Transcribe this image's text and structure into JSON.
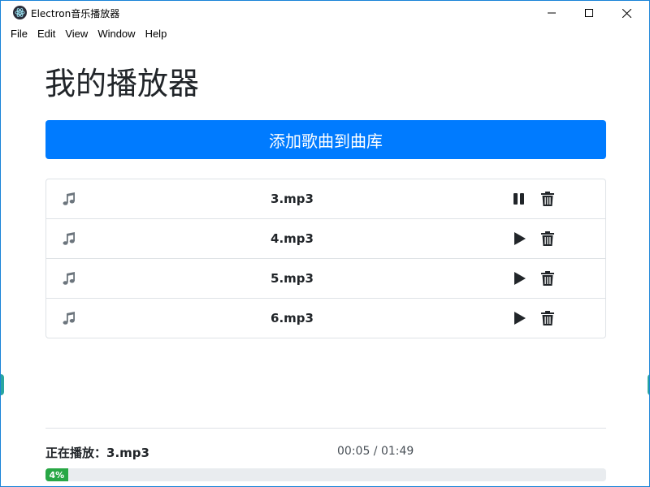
{
  "window": {
    "title": "Electron音乐播放器",
    "icon": "electron-icon",
    "controls": [
      "minimize-icon",
      "maximize-icon",
      "close-icon"
    ]
  },
  "menu": [
    "File",
    "Edit",
    "View",
    "Window",
    "Help"
  ],
  "main": {
    "title": "我的播放器",
    "add_button_label": "添加歌曲到曲库",
    "add_button_color": "#007bff"
  },
  "songs": [
    {
      "name": "3.mp3",
      "state": "playing",
      "note_icon": "music-note-icon",
      "action_icon": "pause-icon",
      "delete_icon": "trash-icon"
    },
    {
      "name": "4.mp3",
      "state": "stopped",
      "note_icon": "music-note-icon",
      "action_icon": "play-icon",
      "delete_icon": "trash-icon"
    },
    {
      "name": "5.mp3",
      "state": "stopped",
      "note_icon": "music-note-icon",
      "action_icon": "play-icon",
      "delete_icon": "trash-icon"
    },
    {
      "name": "6.mp3",
      "state": "stopped",
      "note_icon": "music-note-icon",
      "action_icon": "play-icon",
      "delete_icon": "trash-icon"
    }
  ],
  "player": {
    "now_playing_label": "正在播放：3.mp3",
    "time": "00:05 / 01:49",
    "progress_percent": 4,
    "progress_label": "4%",
    "progress_color": "#28a745"
  }
}
